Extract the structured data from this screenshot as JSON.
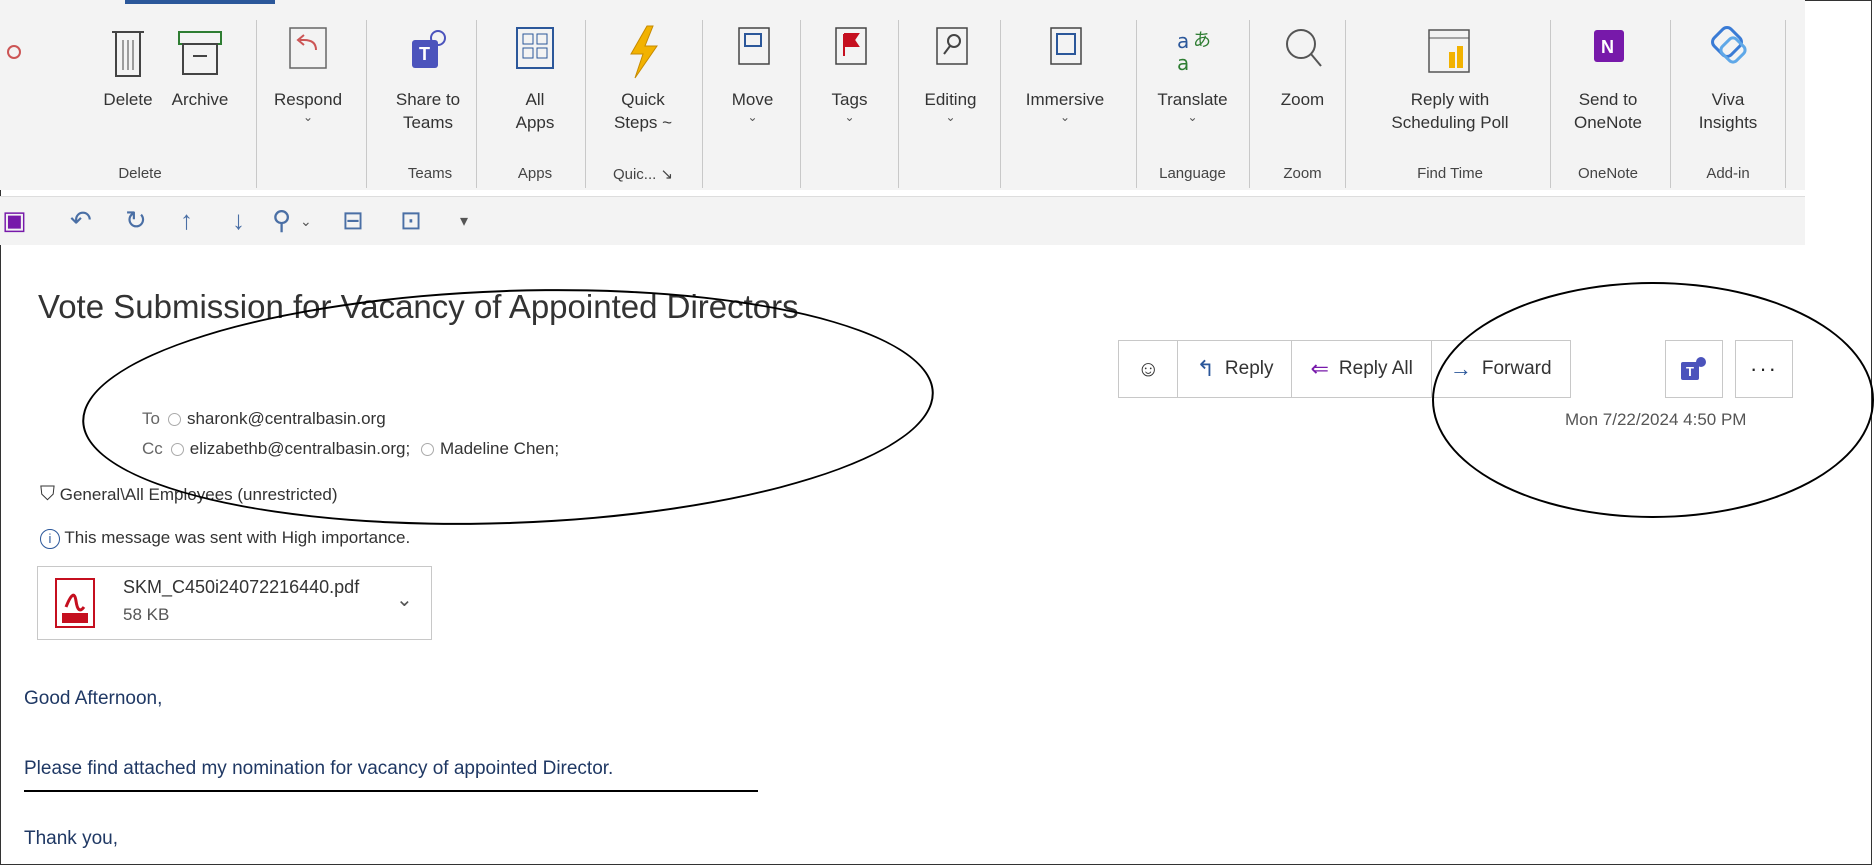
{
  "ribbon": {
    "buttons": {
      "delete": "Delete",
      "archive": "Archive",
      "respond": "Respond",
      "share_teams": "Share to\nTeams",
      "all_apps": "All\nApps",
      "quick_steps": "Quick\nSteps ~",
      "move": "Move",
      "tags": "Tags",
      "editing": "Editing",
      "immersive": "Immersive",
      "translate": "Translate",
      "zoom": "Zoom",
      "reply_poll": "Reply with\nScheduling Poll",
      "send_onenote": "Send to\nOneNote",
      "viva": "Viva\nInsights"
    },
    "groups": {
      "delete": "Delete",
      "teams": "Teams",
      "apps": "Apps",
      "quick": "Quic...",
      "language": "Language",
      "zoom": "Zoom",
      "find_time": "Find Time",
      "onenote": "OneNote",
      "addin": "Add-in"
    }
  },
  "message": {
    "subject": "Vote Submission for Vacancy of Appointed Directors",
    "to_label": "To",
    "to": "sharonk@centralbasin.org",
    "cc_label": "Cc",
    "cc_1": "elizabethb@centralbasin.org;",
    "cc_2": "Madeline Chen;",
    "date": "Mon 7/22/2024 4:50 PM",
    "sensitivity": "General\\All Employees (unrestricted)",
    "importance": "This message was sent with High importance.",
    "attachment": {
      "name": "SKM_C450i24072216440.pdf",
      "size": "58 KB"
    },
    "body": {
      "greeting": "Good Afternoon,",
      "line": "Please find attached my nomination for vacancy of appointed Director.",
      "closing": "Thank you,"
    }
  },
  "actions": {
    "reply": "Reply",
    "reply_all": "Reply All",
    "forward": "Forward"
  },
  "colors": {
    "accent": "#2b579a",
    "teams": "#4b53bc",
    "onenote": "#7719aa",
    "body_text": "#1f3864",
    "tag_flag": "#c50f1f"
  }
}
